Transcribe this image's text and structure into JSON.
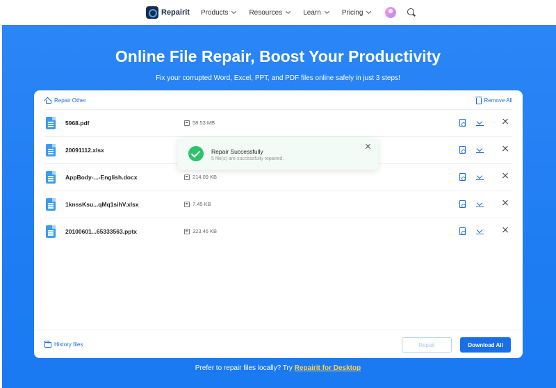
{
  "nav": {
    "logo_text": "Repairit",
    "items": [
      {
        "label": "Products"
      },
      {
        "label": "Resources"
      },
      {
        "label": "Learn"
      },
      {
        "label": "Pricing"
      }
    ]
  },
  "hero": {
    "title": "Online File Repair, Boost Your Productivity",
    "subtitle": "Fix your corrupted Word, Excel, PPT, and PDF files online safely in just 3 steps!"
  },
  "card": {
    "repair_other": "Repair Other",
    "remove_all": "Remove All",
    "files": [
      {
        "name": "5968.pdf",
        "size": "58.53 MB"
      },
      {
        "name": "20091112.xlsx",
        "size": ""
      },
      {
        "name": "AppBody-...-English.docx",
        "size": "214.09 KB"
      },
      {
        "name": "1knssKsu...qMq1sihV.xlsx",
        "size": "7.45 KB"
      },
      {
        "name": "20100601...65333563.pptx",
        "size": "323.46 KB"
      }
    ],
    "history_files": "History files",
    "repair_button": "Repair",
    "download_all_button": "Download All"
  },
  "toast": {
    "title": "Repair Successfully",
    "message": "5 file(s) are successfully repaired."
  },
  "footer": {
    "prompt": "Prefer to repair files locally? Try ",
    "link": "Repairit for Desktop"
  },
  "colors": {
    "accent": "#1a6fe8",
    "hero_blue": "#1f7df3",
    "success_green": "#2ec36a",
    "link_yellow": "#ffd24a"
  }
}
